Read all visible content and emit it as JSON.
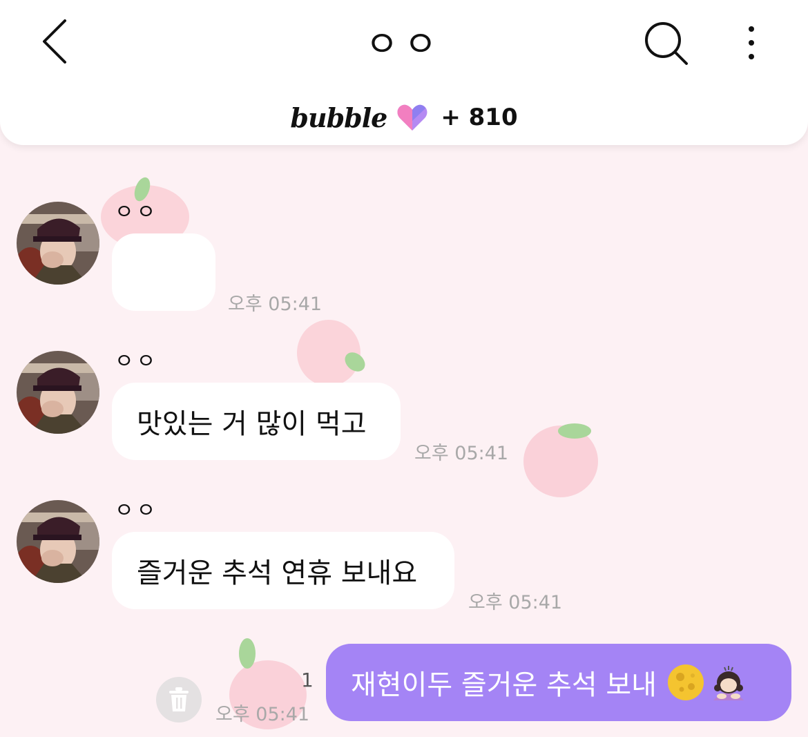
{
  "header": {
    "title": "ㅇㅇ",
    "brand": "bubble",
    "bubble_count": "+ 810",
    "icons": [
      "chevron-left-icon",
      "search-icon",
      "more-vertical-icon",
      "heart-icon"
    ]
  },
  "messages": [
    {
      "sender": "ㅇㅇ",
      "text": "",
      "time": "오후 05:41"
    },
    {
      "sender": "ㅇㅇ",
      "text": "맛있는 거 많이 먹고",
      "time": "오후 05:41"
    },
    {
      "sender": "ㅇㅇ",
      "text": "즐거운 추석 연휴 보내요",
      "time": "오후 05:41"
    }
  ],
  "my_message": {
    "text": "재현이두 즐거운 추석 보내",
    "emojis": [
      "full-moon-emoji",
      "person-bowing-emoji"
    ],
    "time": "오후 05:41",
    "unread": "1"
  },
  "colors": {
    "background": "#fdf1f4",
    "my_bubble": "#a484f5",
    "timestamp": "#a8a8a8"
  }
}
